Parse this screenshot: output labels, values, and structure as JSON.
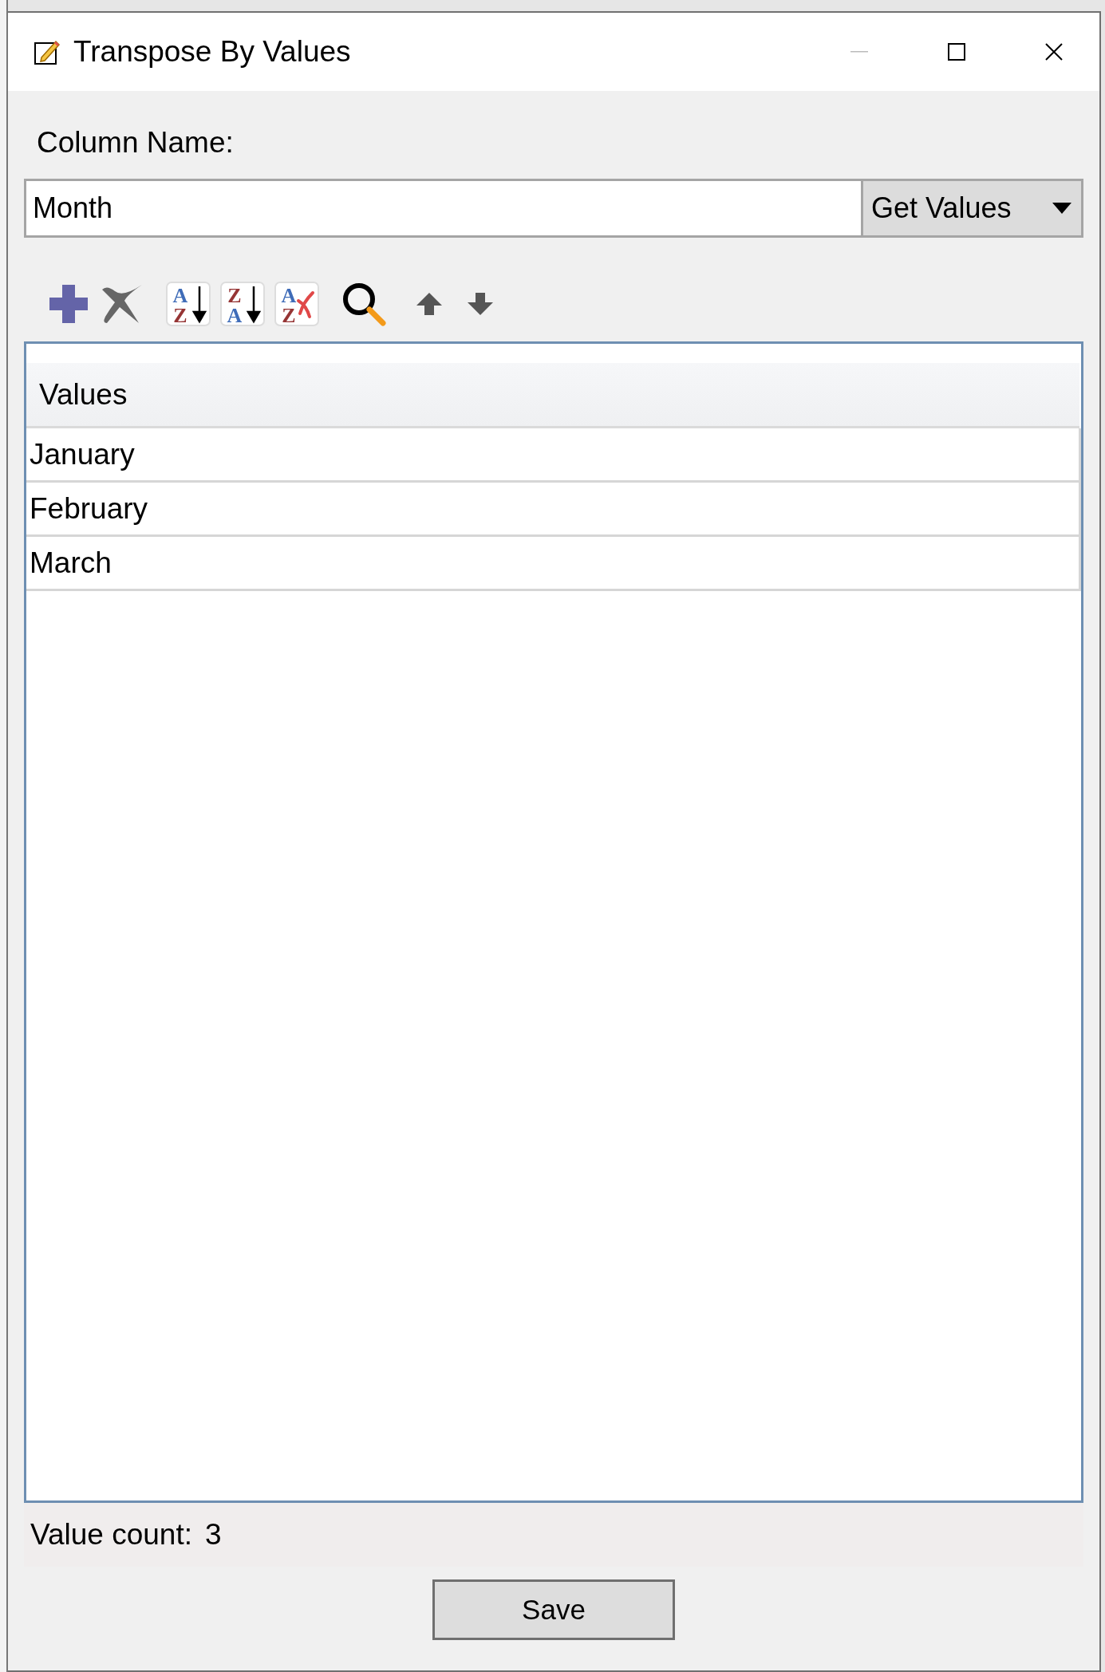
{
  "window": {
    "title": "Transpose By Values"
  },
  "column_name": {
    "label": "Column Name:",
    "value": "Month",
    "button": "Get Values"
  },
  "toolbar": [
    {
      "kind": "add"
    },
    {
      "kind": "delete"
    },
    {
      "kind": "sort_asc",
      "top": "A",
      "bottom": "Z"
    },
    {
      "kind": "sort_desc",
      "top": "Z",
      "bottom": "A"
    },
    {
      "kind": "sort_clear",
      "top": "A",
      "bottom": "Z"
    },
    {
      "kind": "search"
    },
    {
      "kind": "up"
    },
    {
      "kind": "down"
    }
  ],
  "table": {
    "columns": [
      "Values"
    ],
    "rows": [
      "January",
      "February",
      "March"
    ]
  },
  "value_count": {
    "label": "Value count:",
    "value": "3"
  },
  "buttons": [
    "Save"
  ]
}
